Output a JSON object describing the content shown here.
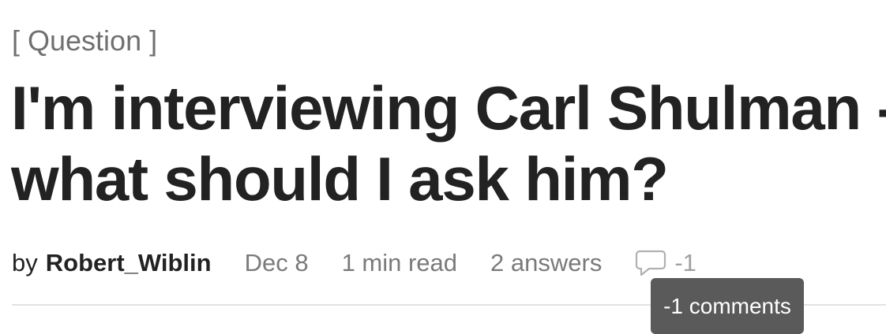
{
  "post": {
    "tag": "[ Question ]",
    "title_line1": "I'm interviewing Carl Shulman -",
    "title_line2": "what should I ask him?",
    "by_label": "by",
    "author": "Robert_Wiblin",
    "date": "Dec 8",
    "read_time": "1 min read",
    "answers": "2 answers",
    "comment_count": "-1",
    "comment_icon": "comment-bubble-icon"
  },
  "tooltip": {
    "text": "-1 comments"
  },
  "colors": {
    "title": "#222222",
    "meta": "#7a7a7a",
    "tooltip_bg": "#5a5a5a",
    "divider": "#e2e2e2"
  }
}
